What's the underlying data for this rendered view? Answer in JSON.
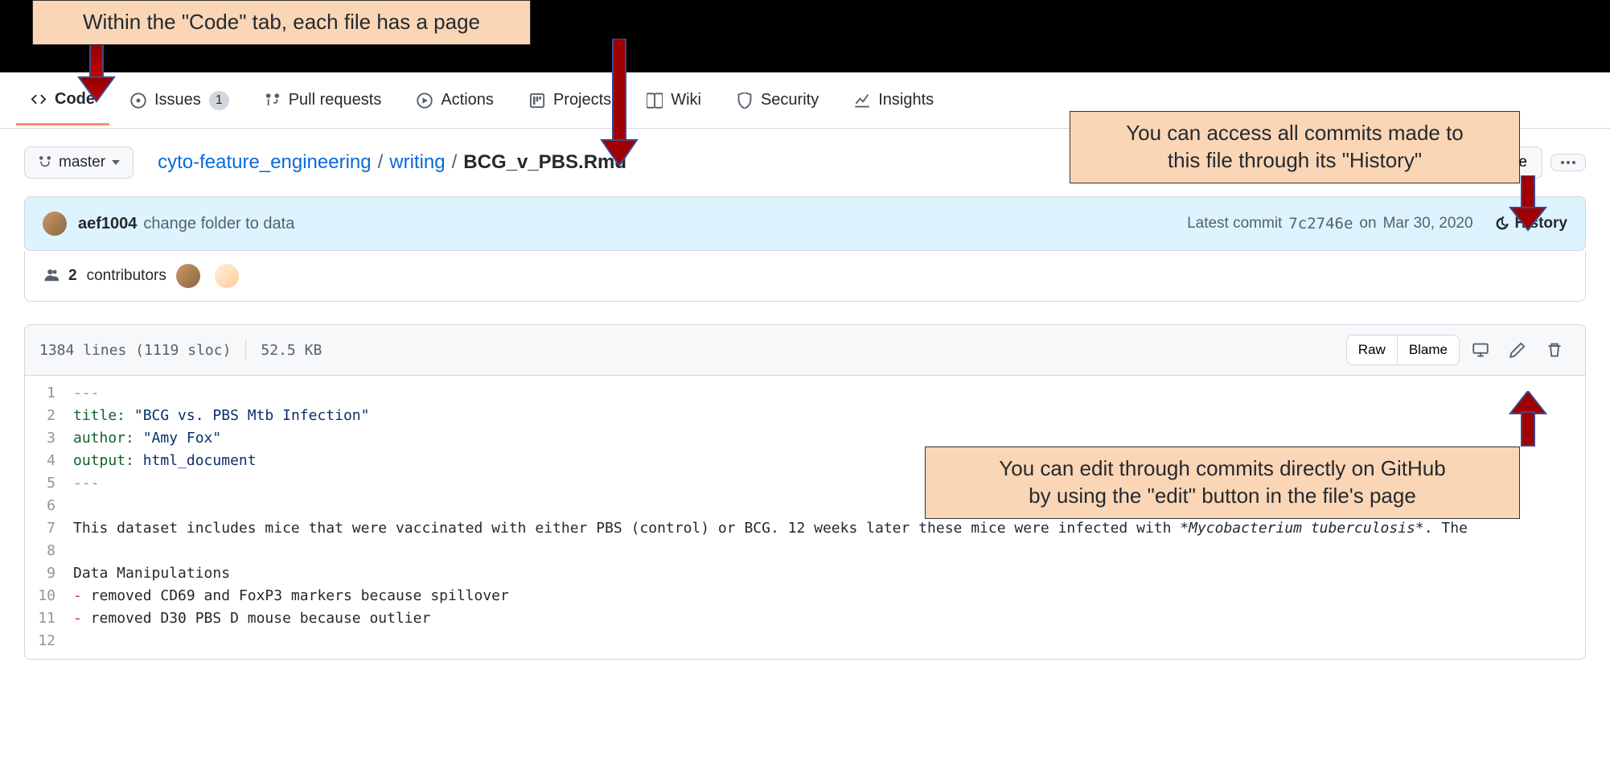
{
  "tabs": {
    "code": "Code",
    "issues": "Issues",
    "issues_count": "1",
    "pulls": "Pull requests",
    "actions": "Actions",
    "projects": "Projects",
    "wiki": "Wiki",
    "security": "Security",
    "insights": "Insights"
  },
  "branch": {
    "name": "master"
  },
  "breadcrumb": {
    "repo": "cyto-feature_engineering",
    "folder": "writing",
    "file": "BCG_v_PBS.Rmd"
  },
  "buttons": {
    "gotofile": "Go to file",
    "raw": "Raw",
    "blame": "Blame"
  },
  "commit": {
    "author": "aef1004",
    "message": "change folder to data",
    "latest_label": "Latest commit",
    "sha": "7c2746e",
    "date_prefix": "on",
    "date": "Mar 30, 2020",
    "history": "History"
  },
  "contributors": {
    "count_label": "2",
    "label": "contributors"
  },
  "filestats": {
    "lines": "1384 lines (1119 sloc)",
    "size": "52.5 KB"
  },
  "source": {
    "dashes": "---",
    "title_key": "title:",
    "title_val": "\"BCG vs. PBS Mtb Infection\"",
    "author_key": "author:",
    "author_val": "\"Amy Fox\"",
    "output_key": "output:",
    "output_val": "html_document",
    "line7_a": "This dataset includes mice that were vaccinated with either PBS (control) or BCG. 12 weeks later these mice were infected with *",
    "line7_b": "Mycobacterium tuberculosis",
    "line7_c": "*. The",
    "line9": "Data Manipulations",
    "line10_prefix": "-",
    "line10": " removed CD69 and FoxP3 markers because spillover",
    "line11_prefix": "-",
    "line11": " removed D30 PBS D mouse because outlier"
  },
  "callouts": {
    "top": "Within the \"Code\" tab, each file has a page",
    "history": "You can access all commits made to\nthis file through its \"History\"",
    "edit": "You can edit through commits directly on GitHub\nby using the \"edit\" button in the file's page"
  }
}
